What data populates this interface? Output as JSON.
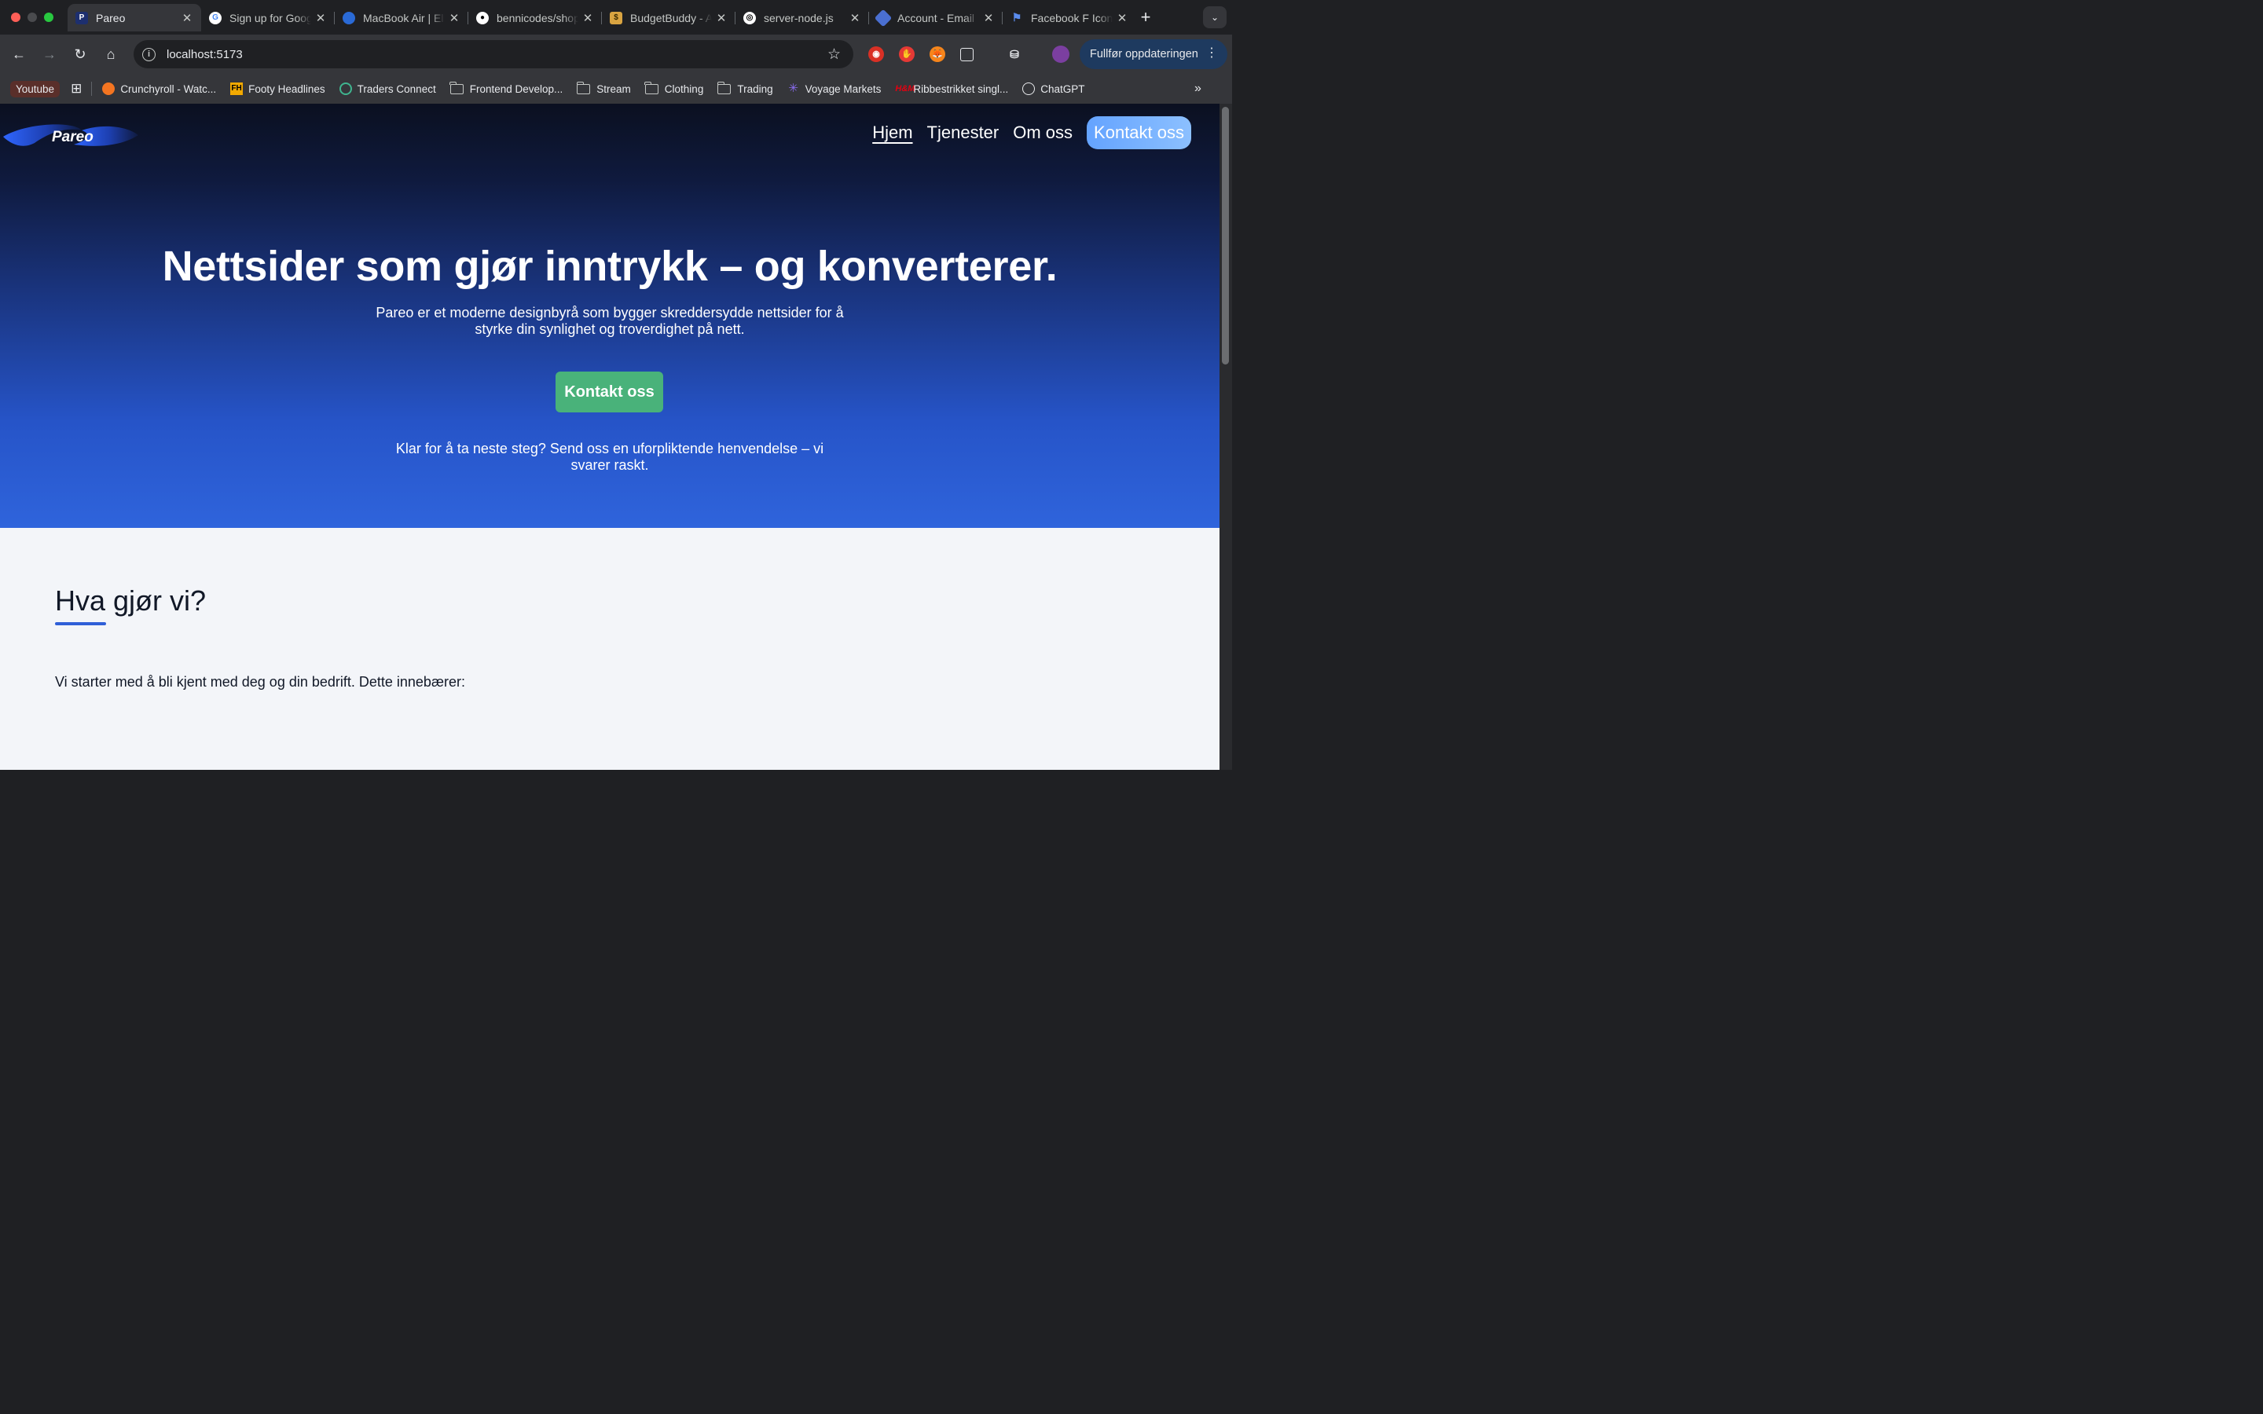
{
  "browser": {
    "tabs": [
      {
        "title": "Pareo",
        "icon": "pareo-favicon",
        "active": true
      },
      {
        "title": "Sign up for Google",
        "icon": "google-icon"
      },
      {
        "title": "MacBook Air | Elkjøp",
        "icon": "elkjop-icon"
      },
      {
        "title": "bennicodes/shop",
        "icon": "github-icon"
      },
      {
        "title": "BudgetBuddy - App",
        "icon": "budget-icon"
      },
      {
        "title": "server-node.js",
        "icon": "chatgpt-icon"
      },
      {
        "title": "Account - Email",
        "icon": "account-icon"
      },
      {
        "title": "Facebook F Icon",
        "icon": "flag-icon"
      }
    ],
    "new_tab": "+",
    "url": "localhost:5173",
    "update_button": "Fullfør oppdateringen",
    "bookmarks": [
      {
        "label": "Youtube",
        "type": "chip"
      },
      {
        "label": "Crunchyroll - Watc...",
        "type": "site",
        "icon": "crunchyroll-icon"
      },
      {
        "label": "Footy Headlines",
        "type": "site",
        "icon": "fh-icon"
      },
      {
        "label": "Traders Connect",
        "type": "site",
        "icon": "traders-icon"
      },
      {
        "label": "Frontend Develop...",
        "type": "folder"
      },
      {
        "label": "Stream",
        "type": "folder"
      },
      {
        "label": "Clothing",
        "type": "folder"
      },
      {
        "label": "Trading",
        "type": "folder"
      },
      {
        "label": "Voyage Markets",
        "type": "site",
        "icon": "voyage-icon"
      },
      {
        "label": "Ribbestrikket singl...",
        "type": "site",
        "icon": "hm-icon"
      },
      {
        "label": "ChatGPT",
        "type": "site",
        "icon": "chatgpt-icon"
      }
    ]
  },
  "site": {
    "logo": "Pareo",
    "nav": [
      "Hjem",
      "Tjenester",
      "Om oss"
    ],
    "nav_cta": "Kontakt oss",
    "hero_title": "Nettsider som gjør inntrykk – og konverterer.",
    "hero_subtitle": "Pareo er et moderne designbyrå som bygger skreddersydde nettsider for å styrke din synlighet og troverdighet på nett.",
    "hero_button": "Kontakt oss",
    "hero_note": "Klar for å ta neste steg? Send oss en uforpliktende henvendelse – vi svarer raskt.",
    "section_title": "Hva gjør vi?",
    "section_body": "Vi starter med å bli kjent med deg og din bedrift. Dette innebærer:"
  },
  "colors": {
    "hero_top": "#0b1020",
    "hero_bottom": "#2f64dc",
    "cta_green": "#49b27a",
    "accent_blue": "#2f5fd8"
  }
}
